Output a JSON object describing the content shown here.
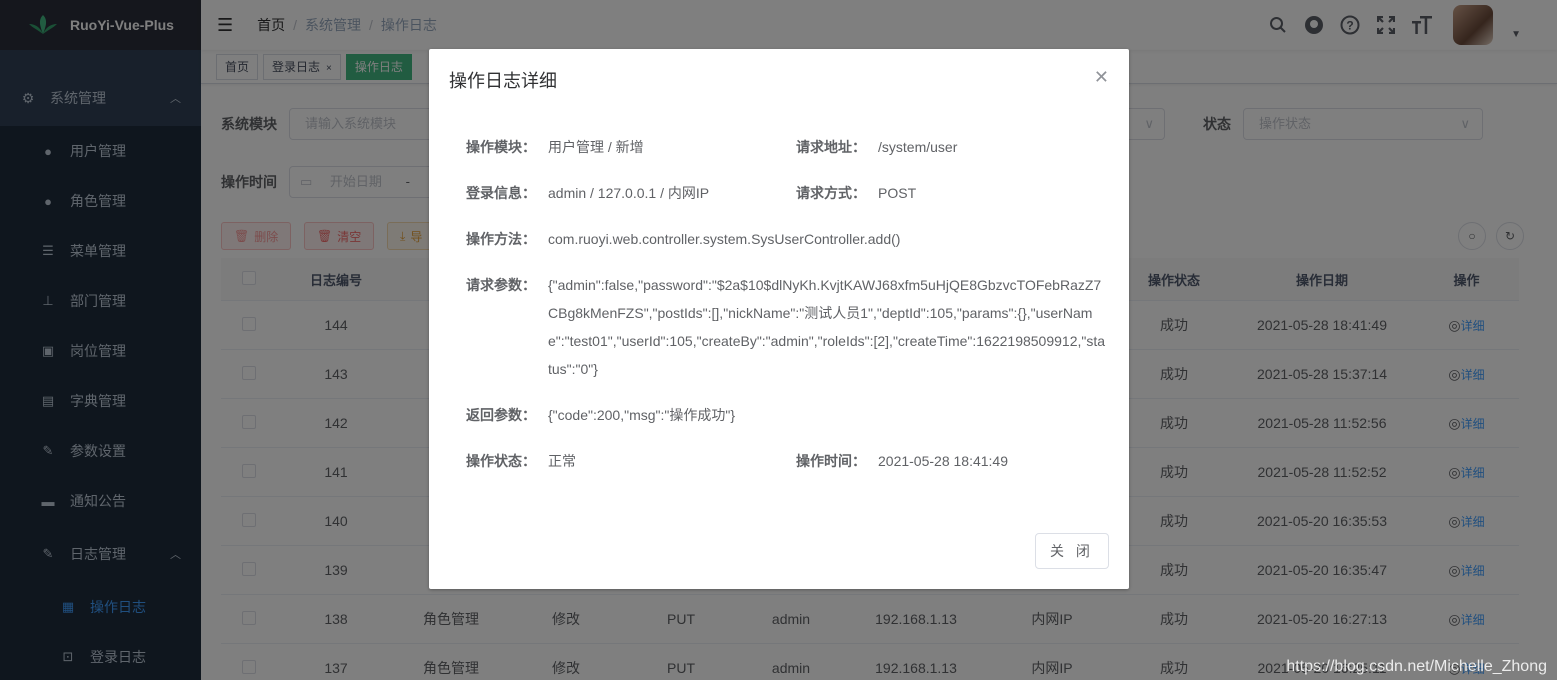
{
  "app": {
    "title": "RuoYi-Vue-Plus"
  },
  "sidebar": {
    "group_system": "系统管理",
    "items": [
      {
        "label": "用户管理",
        "icon": "user-icon"
      },
      {
        "label": "角色管理",
        "icon": "peoples-icon"
      },
      {
        "label": "菜单管理",
        "icon": "tree-table-icon"
      },
      {
        "label": "部门管理",
        "icon": "tree-icon"
      },
      {
        "label": "岗位管理",
        "icon": "post-icon"
      },
      {
        "label": "字典管理",
        "icon": "dict-icon"
      },
      {
        "label": "参数设置",
        "icon": "edit-icon"
      },
      {
        "label": "通知公告",
        "icon": "message-icon"
      }
    ],
    "group_log": "日志管理",
    "log_items": [
      {
        "label": "操作日志",
        "icon": "form-icon",
        "active": true
      },
      {
        "label": "登录日志",
        "icon": "logininfor-icon",
        "active": false
      }
    ]
  },
  "breadcrumb": [
    "首页",
    "系统管理",
    "操作日志"
  ],
  "tags": [
    {
      "label": "首页",
      "closable": false
    },
    {
      "label": "登录日志",
      "closable": true
    },
    {
      "label": "操作日志",
      "closable": true,
      "active": true
    }
  ],
  "search": {
    "module_label": "系统模块",
    "module_placeholder": "请输入系统模块",
    "status_label": "状态",
    "status_placeholder": "操作状态",
    "time_label": "操作时间",
    "start_placeholder": "开始日期",
    "range_sep": "-"
  },
  "toolbar": {
    "delete": "删除",
    "clear": "清空",
    "export": "导"
  },
  "table": {
    "headers": [
      "日志编号",
      "",
      "",
      "",
      "",
      "",
      "",
      "操作状态",
      "操作日期",
      "操作"
    ],
    "rows": [
      {
        "id": "144",
        "module": "",
        "type": "",
        "method": "",
        "user": "",
        "ip": "",
        "loc": "",
        "status": "成功",
        "date": "2021-05-28 18:41:49"
      },
      {
        "id": "143",
        "module": "",
        "type": "",
        "method": "",
        "user": "",
        "ip": "",
        "loc": "",
        "status": "成功",
        "date": "2021-05-28 15:37:14"
      },
      {
        "id": "142",
        "module": "",
        "type": "",
        "method": "",
        "user": "",
        "ip": "",
        "loc": "",
        "status": "成功",
        "date": "2021-05-28 11:52:56"
      },
      {
        "id": "141",
        "module": "",
        "type": "",
        "method": "",
        "user": "",
        "ip": "",
        "loc": "",
        "status": "成功",
        "date": "2021-05-28 11:52:52"
      },
      {
        "id": "140",
        "module": "",
        "type": "",
        "method": "",
        "user": "",
        "ip": "",
        "loc": "",
        "status": "成功",
        "date": "2021-05-20 16:35:53"
      },
      {
        "id": "139",
        "module": "",
        "type": "",
        "method": "",
        "user": "",
        "ip": "",
        "loc": "",
        "status": "成功",
        "date": "2021-05-20 16:35:47"
      },
      {
        "id": "138",
        "module": "角色管理",
        "type": "修改",
        "method": "PUT",
        "user": "admin",
        "ip": "192.168.1.13",
        "loc": "内网IP",
        "status": "成功",
        "date": "2021-05-20 16:27:13"
      },
      {
        "id": "137",
        "module": "角色管理",
        "type": "修改",
        "method": "PUT",
        "user": "admin",
        "ip": "192.168.1.13",
        "loc": "内网IP",
        "status": "成功",
        "date": "2021-05-20 16:25:11"
      }
    ],
    "detail_label": "详细"
  },
  "dialog": {
    "title": "操作日志详细",
    "fields": {
      "module_label": "操作模块：",
      "module_value": "用户管理 / 新增",
      "url_label": "请求地址：",
      "url_value": "/system/user",
      "login_label": "登录信息：",
      "login_value": "admin / 127.0.0.1 / 内网IP",
      "reqmethod_label": "请求方式：",
      "reqmethod_value": "POST",
      "method_label": "操作方法：",
      "method_value": "com.ruoyi.web.controller.system.SysUserController.add()",
      "params_label": "请求参数：",
      "params_value": "{\"admin\":false,\"password\":\"$2a$10$dlNyKh.KvjtKAWJ68xfm5uHjQE8GbzvcTOFebRazZ7CBg8kMenFZS\",\"postIds\":[],\"nickName\":\"测试人员1\",\"deptId\":105,\"params\":{},\"userName\":\"test01\",\"userId\":105,\"createBy\":\"admin\",\"roleIds\":[2],\"createTime\":1622198509912,\"status\":\"0\"}",
      "result_label": "返回参数：",
      "result_value": "{\"code\":200,\"msg\":\"操作成功\"}",
      "status_label": "操作状态：",
      "status_value": "正常",
      "time_label": "操作时间：",
      "time_value": "2021-05-28 18:41:49"
    },
    "close_button": "关 闭"
  },
  "watermark": "https://blog.csdn.net/Michelle_Zhong"
}
